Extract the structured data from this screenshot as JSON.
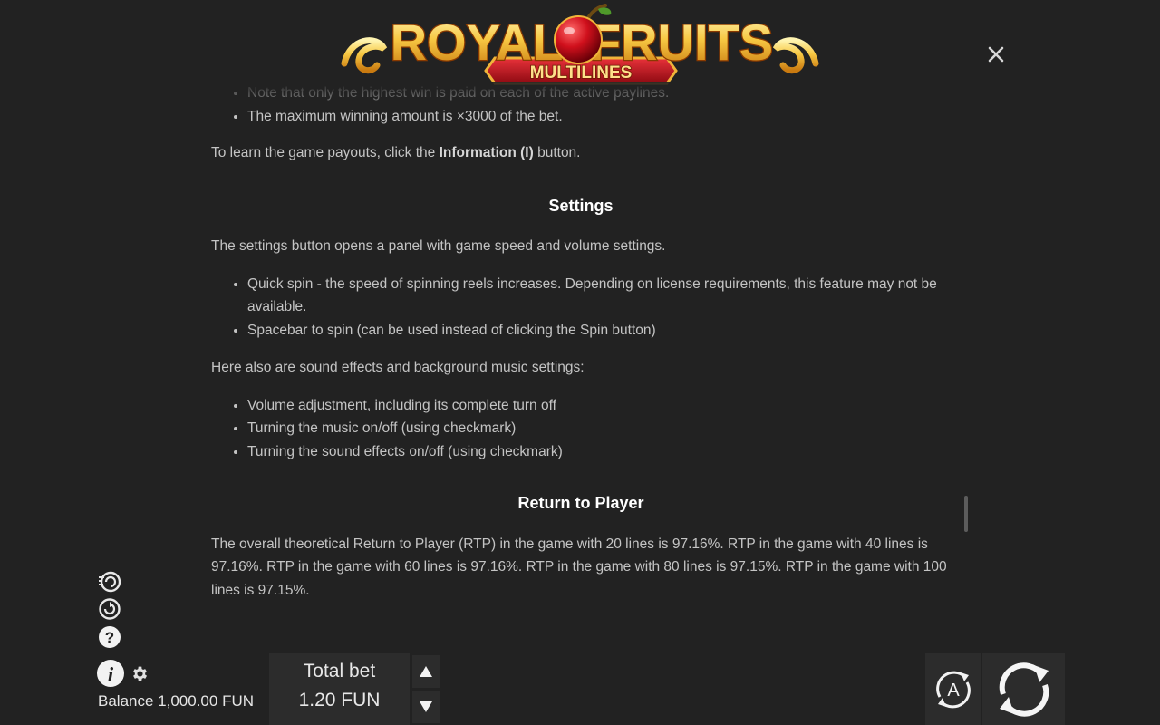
{
  "header": {
    "logo_title_left": "ROYAL",
    "logo_title_right": "FRUITS",
    "logo_subtitle": "MULTILINES",
    "close_icon": "close-icon"
  },
  "rules": {
    "bullets_top": [
      "Note that only the highest win is paid on each of the active paylines.",
      "The maximum winning amount is ×3000 of the bet."
    ],
    "payouts_text_before": "To learn the game payouts, click the ",
    "payouts_text_bold": "Information (I)",
    "payouts_text_after": " button.",
    "settings_heading": "Settings",
    "settings_intro": "The settings button opens a panel with game speed and volume settings.",
    "settings_bullets": [
      "Quick spin - the speed of spinning reels increases. Depending on license requirements, this feature may not be available.",
      "Spacebar to spin (can be used instead of clicking the Spin button)"
    ],
    "sound_intro": "Here also are sound effects and background music settings:",
    "sound_bullets": [
      "Volume adjustment, including its complete turn off",
      "Turning the music on/off (using checkmark)",
      "Turning the sound effects on/off (using checkmark)"
    ],
    "rtp_heading": "Return to Player",
    "rtp_text": "The overall theoretical Return to Player (RTP) in the game with 20 lines is 97.16%. RTP in the game with 40 lines is 97.16%. RTP in the game with 60 lines is 97.16%. RTP in the game with 80 lines is 97.15%. RTP in the game with 100 lines is 97.15%."
  },
  "sidebar": {
    "icons": [
      "fast-spin-icon",
      "history-icon",
      "help-icon",
      "info-icon",
      "gear-icon"
    ]
  },
  "footer": {
    "balance_label": "Balance",
    "balance_value": "1,000.00 FUN",
    "total_bet_label": "Total bet",
    "total_bet_value": "1.20 FUN",
    "autoplay_letter": "A"
  },
  "colors": {
    "background": "#222222",
    "panel": "#2c2c2c",
    "text": "#c4c4c4",
    "heading": "#ffffff",
    "logo_gold": "#f5c542",
    "logo_red": "#c0141c"
  }
}
